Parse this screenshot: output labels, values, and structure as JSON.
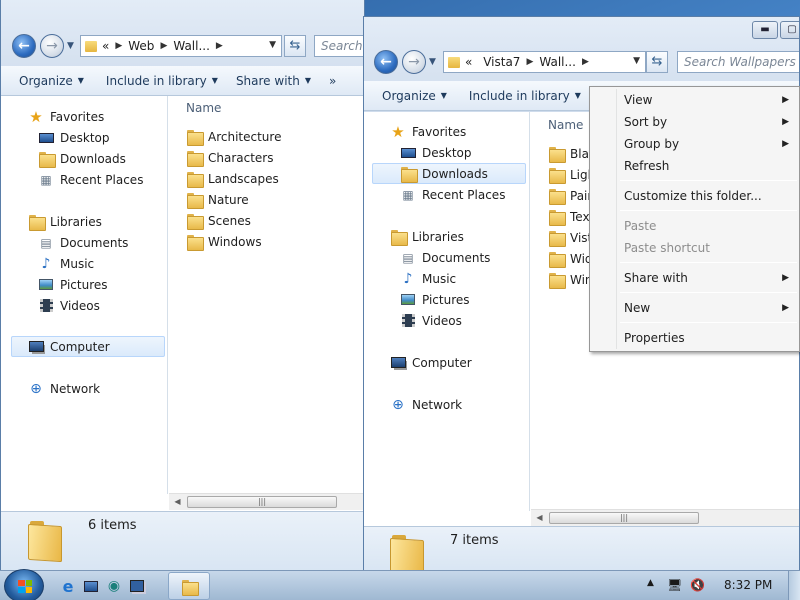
{
  "left_window": {
    "breadcrumb": [
      "«",
      "Web",
      "Wall..."
    ],
    "search_placeholder": "Search",
    "toolbar": {
      "organize": "Organize",
      "include": "Include in library",
      "share": "Share with",
      "more": "»"
    },
    "column_name": "Name",
    "nav": {
      "favorites": "Favorites",
      "desktop": "Desktop",
      "downloads": "Downloads",
      "recent": "Recent Places",
      "libraries": "Libraries",
      "documents": "Documents",
      "music": "Music",
      "pictures": "Pictures",
      "videos": "Videos",
      "computer": "Computer",
      "network": "Network"
    },
    "items": [
      "Architecture",
      "Characters",
      "Landscapes",
      "Nature",
      "Scenes",
      "Windows"
    ],
    "status": "6 items"
  },
  "right_window": {
    "breadcrumb": [
      "«",
      "Vista7",
      "Wall..."
    ],
    "search_placeholder": "Search Wallpapers",
    "toolbar": {
      "organize": "Organize",
      "include": "Include in library"
    },
    "column_name": "Name",
    "nav": {
      "favorites": "Favorites",
      "desktop": "Desktop",
      "downloads": "Downloads",
      "recent": "Recent Places",
      "libraries": "Libraries",
      "documents": "Documents",
      "music": "Music",
      "pictures": "Pictures",
      "videos": "Videos",
      "computer": "Computer",
      "network": "Network"
    },
    "items": [
      "Blac",
      "Ligh",
      "Pain",
      "Text",
      "Vista",
      "Wid",
      "Win"
    ],
    "status": "7 items"
  },
  "context_menu": {
    "view": "View",
    "sort_by": "Sort by",
    "group_by": "Group by",
    "refresh": "Refresh",
    "customize": "Customize this folder...",
    "paste": "Paste",
    "paste_shortcut": "Paste shortcut",
    "share_with": "Share with",
    "new": "New",
    "properties": "Properties"
  },
  "taskbar": {
    "clock": "8:32 PM"
  },
  "icons": {
    "back": "back-arrow-icon",
    "forward": "forward-arrow-icon",
    "refresh": "refresh-icon",
    "favorites": "star-icon",
    "computer": "computer-icon",
    "network": "network-icon"
  },
  "colors": {
    "accent": "#2d6cc0",
    "folder": "#e8b94a",
    "selection": "#dbeafb"
  }
}
